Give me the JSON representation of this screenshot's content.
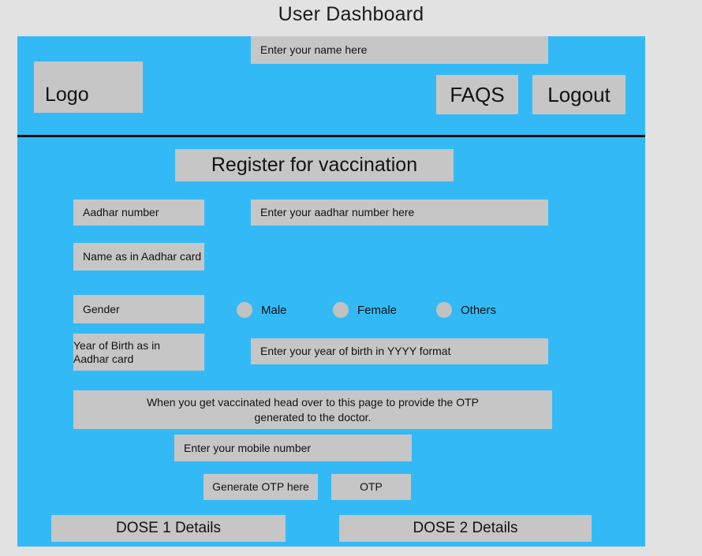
{
  "page": {
    "title": "User Dashboard",
    "background_color": "#e2e2e2",
    "panel_color": "#33baf6",
    "widget_color": "#c6c6c6"
  },
  "header": {
    "logo_label": "Logo",
    "faqs_label": "FAQS",
    "logout_label": "Logout"
  },
  "banner": {
    "title": "Register for vaccination"
  },
  "form": {
    "aadhar": {
      "label": "Aadhar number",
      "placeholder": "Enter your aadhar number here"
    },
    "name": {
      "label": "Name as in Aadhar card",
      "placeholder": "Enter your name here"
    },
    "gender": {
      "label": "Gender",
      "options": [
        {
          "label": "Male",
          "selected": false
        },
        {
          "label": "Female",
          "selected": false
        },
        {
          "label": "Others",
          "selected": false
        }
      ]
    },
    "year_of_birth": {
      "label": "Year of Birth as in Aadhar card",
      "label_line1": "Year of Birth as in",
      "label_line2": "Aadhar card",
      "placeholder": "Enter your year of birth in YYYY format"
    }
  },
  "otp_section": {
    "notice_line1": "When you get vaccinated head over to this page to provide the OTP",
    "notice_line2": "generated to the doctor.",
    "mobile_placeholder": "Enter your mobile number",
    "generate_label": "Generate OTP here",
    "otp_placeholder": "OTP"
  },
  "footer": {
    "dose1_label": "DOSE 1 Details",
    "dose2_label": "DOSE 2 Details"
  }
}
